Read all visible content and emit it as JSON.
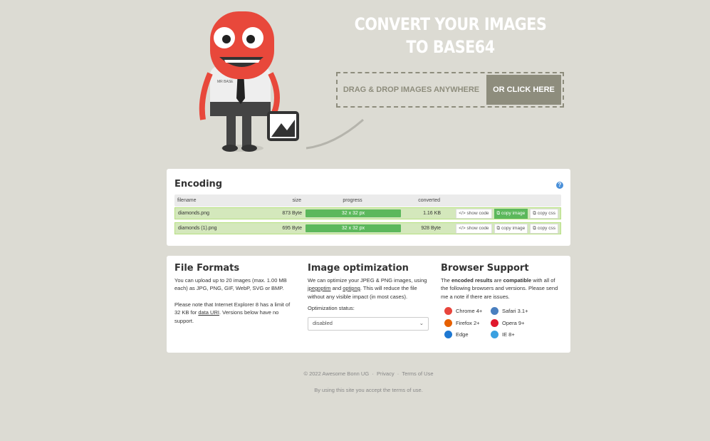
{
  "header": {
    "line1": "CONVERT YOUR IMAGES",
    "line2": "TO BASE64",
    "drop_text": "DRAG & DROP IMAGES ANYWHERE",
    "click_button": "OR CLICK HERE",
    "mascot_shirt": "MR BASE"
  },
  "encoding": {
    "title": "Encoding",
    "help": "?",
    "columns": [
      "filename",
      "size",
      "progress",
      "converted"
    ],
    "rows": [
      {
        "filename": "diamonds.png",
        "size": "873 Byte",
        "progress": "32 x 32 px",
        "progress_pct": 100,
        "converted": "1.16 KB",
        "show_code": "show code",
        "copy_image": "copy image",
        "copy_css": "copy css"
      },
      {
        "filename": "diamonds (1).png",
        "size": "695 Byte",
        "progress": "32 x 32 px",
        "progress_pct": 100,
        "converted": "928 Byte",
        "show_code": "show code",
        "copy_image": "copy image",
        "copy_css": "copy css"
      }
    ]
  },
  "file_formats": {
    "title": "File Formats",
    "p1": "You can upload up to 20 images (max. 1.00 MB each) as JPG, PNG, GIF, WebP, SVG or BMP.",
    "p2a": "Please note that Internet Explorer 8 has a limit of 32 KB for ",
    "p2link": "data URI",
    "p2b": ". Versions below have no support."
  },
  "optimization": {
    "title": "Image optimization",
    "t1": "We can optimize your JPEG & PNG images, using ",
    "link1": "jpegoptim",
    "t2": " and ",
    "link2": "optipng",
    "t3": ". This will reduce the file without any visible impact (in most cases).",
    "status_label": "Optimization status:",
    "status_value": "disabled"
  },
  "browser": {
    "title": "Browser Support",
    "t1": "The ",
    "b1": "encoded results",
    "t2": " are ",
    "b2": "compatible",
    "t3": " with all of the following browsers and versions. Please send me a note if there are issues.",
    "items": [
      {
        "name": "Chrome 4+",
        "color": "#e8453c"
      },
      {
        "name": "Safari 3.1+",
        "color": "#4a7fbf"
      },
      {
        "name": "Firefox 2+",
        "color": "#e66000"
      },
      {
        "name": "Opera 9+",
        "color": "#e0182d"
      },
      {
        "name": "Edge",
        "color": "#1e78d2"
      },
      {
        "name": "IE 8+",
        "color": "#3aa0e0"
      }
    ]
  },
  "footer": {
    "copyright": "© 2022 Awesome Bonn UG",
    "sep": "·",
    "privacy": "Privacy",
    "terms": "Terms of Use",
    "note": "By using this site you accept the terms of use."
  }
}
